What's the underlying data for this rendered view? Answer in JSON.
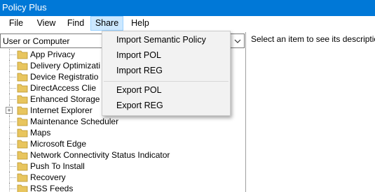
{
  "window": {
    "title": "Policy Plus"
  },
  "menubar": {
    "items": [
      "File",
      "View",
      "Find",
      "Share",
      "Help"
    ]
  },
  "share_menu": {
    "items": [
      "Import Semantic Policy",
      "Import POL",
      "Import REG",
      "Export POL",
      "Export REG"
    ]
  },
  "scope_combo": {
    "value": "User or Computer"
  },
  "tree": {
    "items": [
      "App Privacy",
      "Delivery Optimizati",
      "Device Registratio",
      "DirectAccess Clie",
      "Enhanced Storage",
      "Internet Explorer",
      "Maintenance Scheduler",
      "Maps",
      "Microsoft Edge",
      "Network Connectivity Status Indicator",
      "Push To Install",
      "Recovery",
      "RSS Feeds"
    ]
  },
  "description_pane": {
    "text": "Select an item to see its description."
  },
  "colors": {
    "titlebar": "#0078d7",
    "folder": "#e8c55e",
    "menu_highlight": "#cce8ff"
  }
}
